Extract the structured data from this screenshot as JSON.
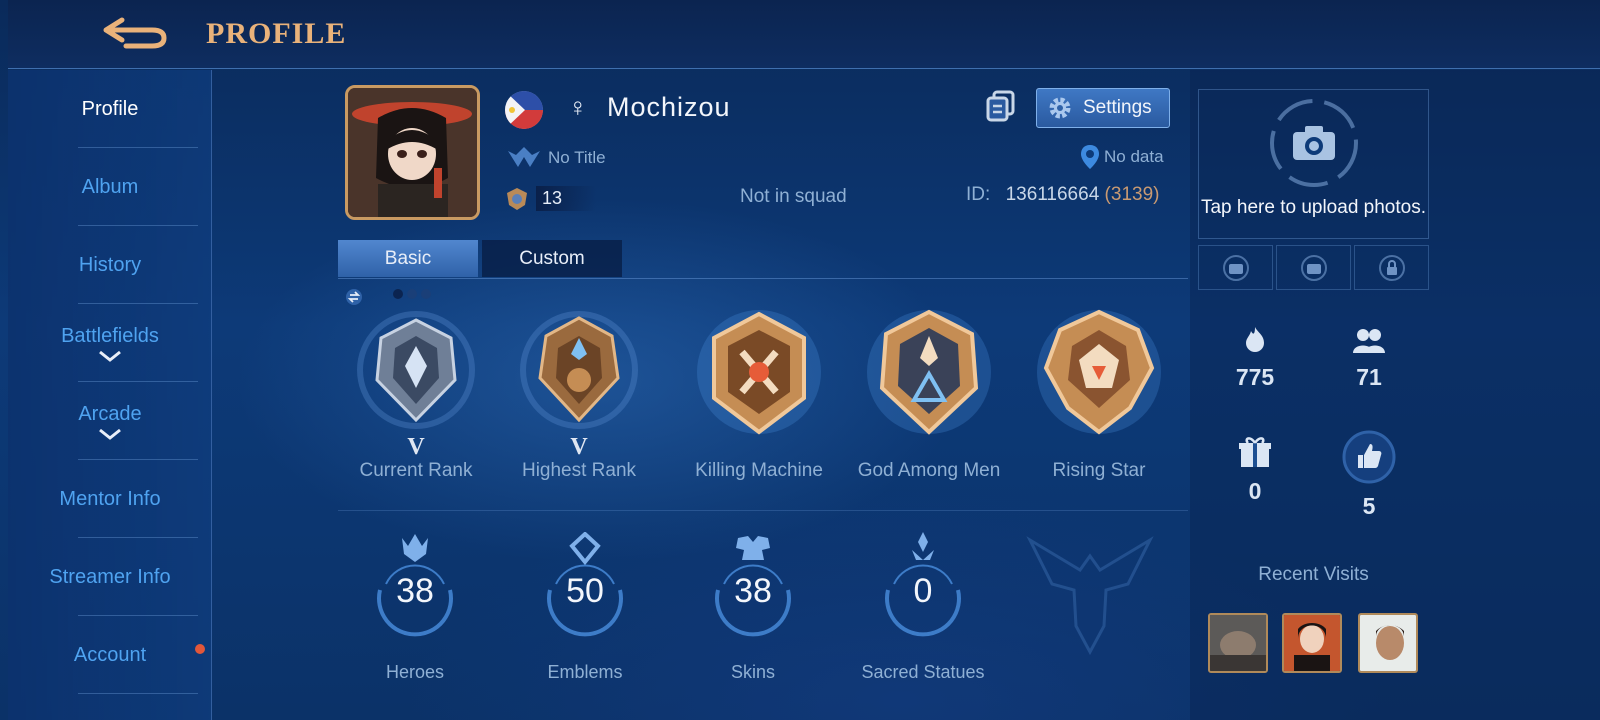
{
  "header": {
    "title": "PROFILE"
  },
  "sidebar": {
    "items": [
      {
        "label": "Profile"
      },
      {
        "label": "Album"
      },
      {
        "label": "History"
      },
      {
        "label": "Battlefields"
      },
      {
        "label": "Arcade"
      },
      {
        "label": "Mentor Info"
      },
      {
        "label": "Streamer Info"
      },
      {
        "label": "Account"
      }
    ]
  },
  "profile": {
    "username": "Mochizou",
    "gender_symbol": "♀",
    "title": "No Title",
    "level": "13",
    "squad": "Not in squad",
    "location": "No data",
    "id_label": "ID:",
    "id_value": "136116664",
    "id_sub": "(3139)",
    "settings_label": "Settings"
  },
  "tabs": [
    {
      "label": "Basic"
    },
    {
      "label": "Custom"
    }
  ],
  "achievements": [
    {
      "label": "Current Rank",
      "tier": "V"
    },
    {
      "label": "Highest Rank",
      "tier": "V"
    },
    {
      "label": "Killing Machine",
      "tier": ""
    },
    {
      "label": "God Among Men",
      "tier": ""
    },
    {
      "label": "Rising Star",
      "tier": ""
    }
  ],
  "stats": [
    {
      "label": "Heroes",
      "value": "38"
    },
    {
      "label": "Emblems",
      "value": "50"
    },
    {
      "label": "Skins",
      "value": "38"
    },
    {
      "label": "Sacred Statues",
      "value": "0"
    }
  ],
  "right_panel": {
    "upload_text": "Tap here to upload photos.",
    "popularity": "775",
    "friends": "71",
    "gifts": "0",
    "likes": "5",
    "recent_visits_title": "Recent Visits"
  },
  "colors": {
    "accent_gold": "#e9b27a",
    "link_blue": "#4fa3f0",
    "muted_text": "#8fb0d4"
  }
}
